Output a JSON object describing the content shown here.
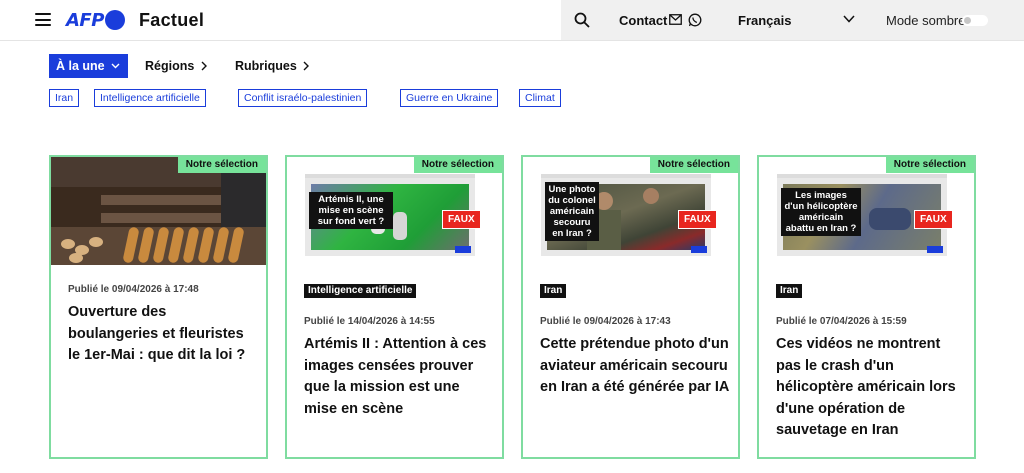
{
  "header": {
    "logo_text": "AFP",
    "brand": "Factuel",
    "contact": "Contact",
    "language": "Français",
    "dark_mode": "Mode sombre"
  },
  "nav": {
    "primary": "À la une",
    "items": [
      "Régions",
      "Rubriques"
    ]
  },
  "tags": [
    "Iran",
    "Intelligence artificielle",
    "Conflit israélo-palestinien",
    "Guerre en Ukraine",
    "Climat"
  ],
  "cards": [
    {
      "badge": "Notre sélection",
      "category": "",
      "date": "Publié le 09/04/2026 à 17:48",
      "title": "Ouverture des boulangeries et fleuristes le 1er-Mai : que dit la loi ?"
    },
    {
      "badge": "Notre sélection",
      "category": "Intelligence artificielle",
      "date": "Publié le 14/04/2026 à 14:55",
      "title": "Artémis II : Attention à ces images censées prouver que la mission est une mise en scène",
      "image_caption": "Artémis II, une mise en scène sur fond vert ?",
      "image_label": "FAUX"
    },
    {
      "badge": "Notre sélection",
      "category": "Iran",
      "date": "Publié le 09/04/2026 à 17:43",
      "title": "Cette prétendue photo d'un aviateur américain secouru en Iran a été générée par IA",
      "image_caption": "Une photo du colonel américain secouru en Iran ?",
      "image_label": "FAUX"
    },
    {
      "badge": "Notre sélection",
      "category": "Iran",
      "date": "Publié le 07/04/2026 à 15:59",
      "title": "Ces vidéos ne montrent pas le crash d'un hélicoptère américain lors d'une opération de sauvetage en Iran",
      "image_caption": "Les images d'un hélicoptère américain abattu en Iran ?",
      "image_label": "FAUX"
    }
  ],
  "colors": {
    "brand_blue": "#1a3ddb",
    "selection_green": "#77e39a",
    "faux_red": "#e8261f"
  }
}
